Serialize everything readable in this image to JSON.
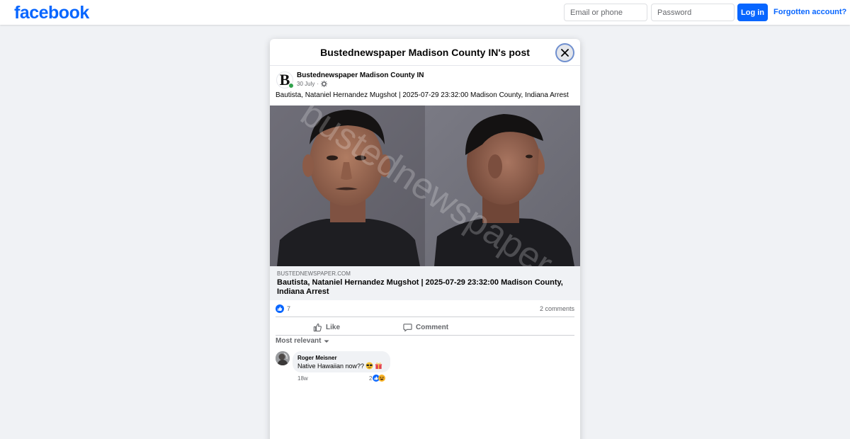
{
  "header": {
    "logo": "facebook",
    "email_placeholder": "Email or phone",
    "password_placeholder": "Password",
    "login_label": "Log in",
    "forgot_label": "Forgotten account?"
  },
  "modal": {
    "title": "Bustednewspaper Madison County IN's post"
  },
  "post": {
    "author": "Bustednewspaper Madison County IN",
    "author_monogram": "B",
    "date": "30 July",
    "date_separator": "·",
    "privacy_icon": "public-gear-icon",
    "text": "Bautista, Nataniel Hernandez Mugshot | 2025-07-29 23:32:00 Madison County, Indiana Arrest",
    "watermark": "bustednewspaper.co",
    "link": {
      "domain": "BUSTEDNEWSPAPER.COM",
      "title": "Bautista, Nataniel Hernandez Mugshot | 2025-07-29 23:32:00 Madison County, Indiana Arrest"
    },
    "reaction_count": "7",
    "comments_count": "2 comments",
    "like_label": "Like",
    "comment_label": "Comment"
  },
  "comments": {
    "sort_label": "Most relevant",
    "items": [
      {
        "author": "Roger Meisner",
        "text": "Native Hawaiian now??",
        "time": "18w",
        "reaction_count": "2"
      }
    ]
  },
  "colors": {
    "brand": "#0866ff",
    "background": "#f0f2f5",
    "online": "#31a24c"
  }
}
